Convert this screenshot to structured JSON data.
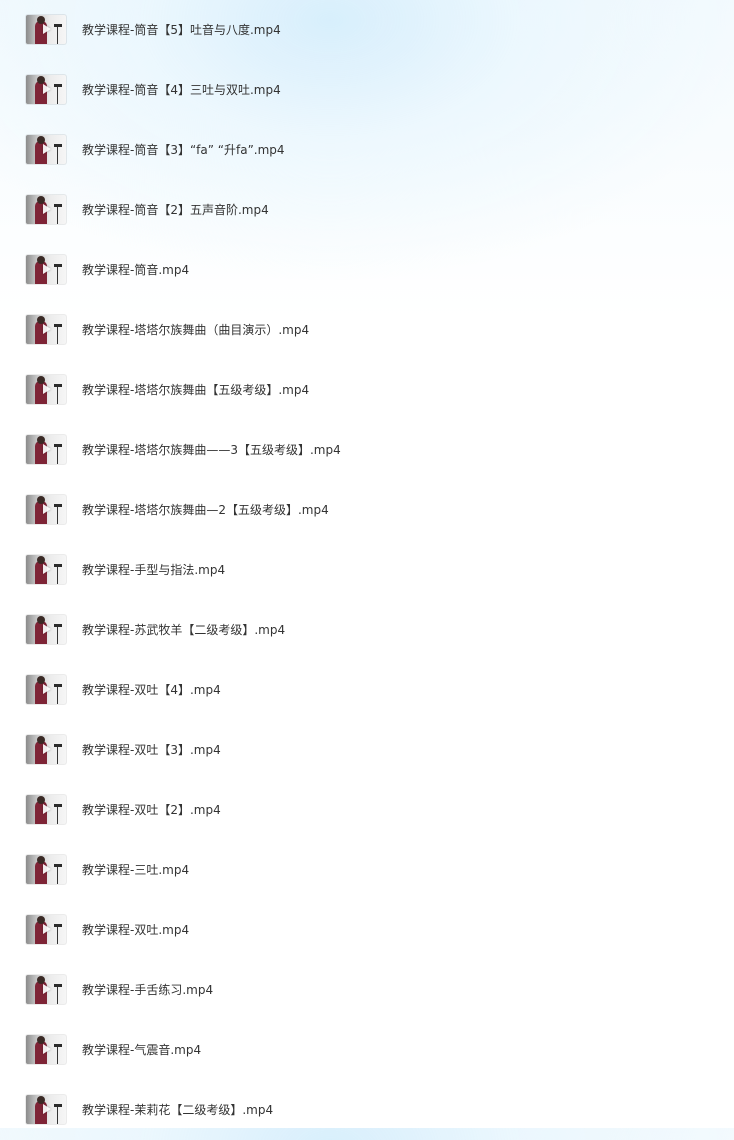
{
  "file_list": {
    "items": [
      {
        "name": "教学课程-筒音【5】吐音与八度.mp4",
        "thumbnail_icon": "video-thumbnail-icon"
      },
      {
        "name": "教学课程-筒音【4】三吐与双吐.mp4",
        "thumbnail_icon": "video-thumbnail-icon"
      },
      {
        "name": "教学课程-筒音【3】“fa” “升fa”.mp4",
        "thumbnail_icon": "video-thumbnail-icon"
      },
      {
        "name": "教学课程-筒音【2】五声音阶.mp4",
        "thumbnail_icon": "video-thumbnail-icon"
      },
      {
        "name": "教学课程-筒音.mp4",
        "thumbnail_icon": "video-thumbnail-icon"
      },
      {
        "name": "教学课程-塔塔尔族舞曲（曲目演示）.mp4",
        "thumbnail_icon": "video-thumbnail-icon"
      },
      {
        "name": "教学课程-塔塔尔族舞曲【五级考级】.mp4",
        "thumbnail_icon": "video-thumbnail-icon"
      },
      {
        "name": "教学课程-塔塔尔族舞曲——3【五级考级】.mp4",
        "thumbnail_icon": "video-thumbnail-icon"
      },
      {
        "name": "教学课程-塔塔尔族舞曲—2【五级考级】.mp4",
        "thumbnail_icon": "video-thumbnail-icon"
      },
      {
        "name": "教学课程-手型与指法.mp4",
        "thumbnail_icon": "video-thumbnail-icon"
      },
      {
        "name": "教学课程-苏武牧羊【二级考级】.mp4",
        "thumbnail_icon": "video-thumbnail-icon"
      },
      {
        "name": "教学课程-双吐【4】.mp4",
        "thumbnail_icon": "video-thumbnail-icon"
      },
      {
        "name": "教学课程-双吐【3】.mp4",
        "thumbnail_icon": "video-thumbnail-icon"
      },
      {
        "name": "教学课程-双吐【2】.mp4",
        "thumbnail_icon": "video-thumbnail-icon"
      },
      {
        "name": "教学课程-三吐.mp4",
        "thumbnail_icon": "video-thumbnail-icon"
      },
      {
        "name": "教学课程-双吐.mp4",
        "thumbnail_icon": "video-thumbnail-icon"
      },
      {
        "name": "教学课程-手舌练习.mp4",
        "thumbnail_icon": "video-thumbnail-icon"
      },
      {
        "name": "教学课程-气震音.mp4",
        "thumbnail_icon": "video-thumbnail-icon"
      },
      {
        "name": "教学课程-茉莉花【二级考级】.mp4",
        "thumbnail_icon": "video-thumbnail-icon"
      }
    ]
  },
  "colors": {
    "text": "#333333",
    "background_tint": "#e8f6fd",
    "thumbnail_garment": "#7e2436"
  }
}
